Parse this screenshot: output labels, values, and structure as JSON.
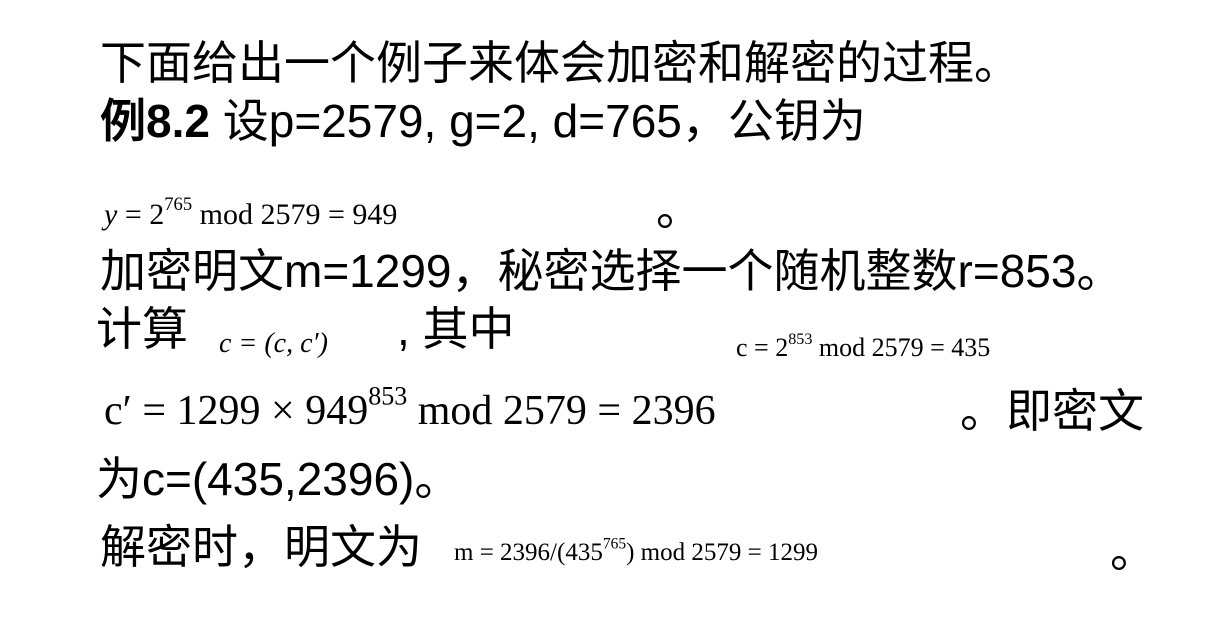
{
  "intro": "下面给出一个例子来体会加密和解密的过程。",
  "example": {
    "label": "例8.2",
    "text": " 设p=2579, g=2, d=765，公钥为"
  },
  "public_key_formula": {
    "lhs": "y",
    "eq_base": " = 2",
    "exp": "765",
    "rest": "  mod 2579 = 949",
    "punct": "。"
  },
  "encrypt_line": "加密明文m=1299，秘密选择一个随机整数r=853。",
  "compute": {
    "label": "计算",
    "formula": "c = (c, c′)",
    "middle": ", 其中",
    "c_formula_base": "c = 2",
    "c_formula_exp": "853",
    "c_formula_rest": "  mod 2579 = 435"
  },
  "cprime": {
    "lhs": "c′ = 1299 × 949",
    "exp": "853",
    "rest": "  mod 2579 = 2396",
    "suffix": "。即密文"
  },
  "ciphertext_line": "为c=(435,2396)。",
  "decrypt": {
    "label": "解密时，明文为",
    "formula_start": "m = 2396/(435",
    "exp": "765",
    "formula_end": ")  mod 2579 = 1299",
    "punct": "。"
  }
}
